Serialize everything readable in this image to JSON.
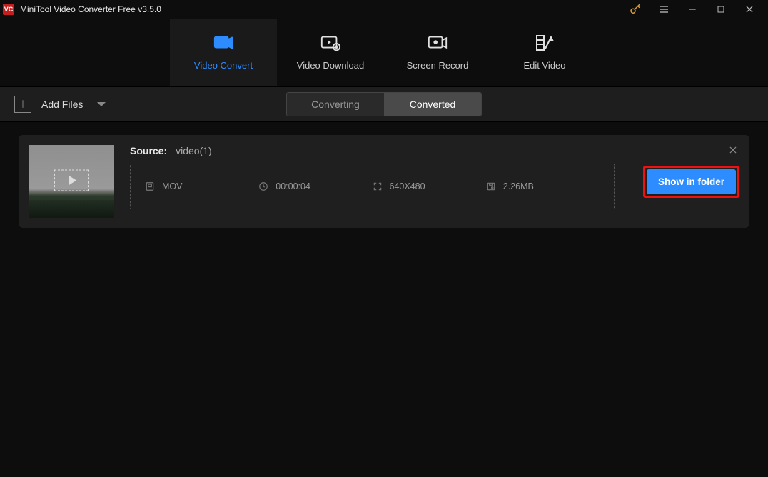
{
  "app": {
    "logo_text": "VC",
    "title": "MiniTool Video Converter Free v3.5.0"
  },
  "main_tabs": {
    "convert": "Video Convert",
    "download": "Video Download",
    "record": "Screen Record",
    "edit": "Edit Video"
  },
  "toolbar": {
    "add_files": "Add Files",
    "seg_converting": "Converting",
    "seg_converted": "Converted"
  },
  "item": {
    "source_label": "Source:",
    "source_name": "video(1)",
    "format": "MOV",
    "duration": "00:00:04",
    "resolution": "640X480",
    "size": "2.26MB",
    "show_in_folder": "Show in folder"
  }
}
